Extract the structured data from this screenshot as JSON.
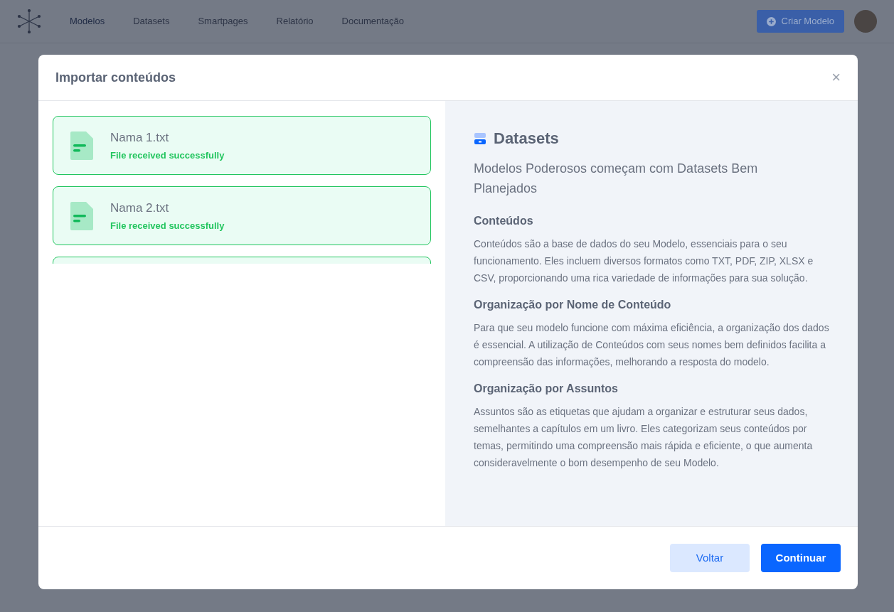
{
  "nav": {
    "items": [
      {
        "label": "Modelos",
        "selected": true
      },
      {
        "label": "Datasets",
        "selected": false
      },
      {
        "label": "Smartpages",
        "selected": false
      },
      {
        "label": "Relatório",
        "selected": false
      },
      {
        "label": "Documentação",
        "selected": false
      }
    ],
    "create_button": "Criar Modelo"
  },
  "modal": {
    "title": "Importar conteúdos",
    "close": "×",
    "files": [
      {
        "name": "Nama 1.txt",
        "status": "File received successfully"
      },
      {
        "name": "Nama 2.txt",
        "status": "File received successfully"
      }
    ],
    "info": {
      "title": "Datasets",
      "subtitle": "Modelos Poderosos começam com Datasets Bem Planejados",
      "sections": [
        {
          "heading": "Conteúdos",
          "text": "Conteúdos são a base de dados do seu Modelo, essenciais para o seu funcionamento. Eles incluem diversos formatos como TXT, PDF, ZIP, XLSX e CSV, proporcionando uma rica variedade de informações para sua solução."
        },
        {
          "heading": "Organização por Nome de Conteúdo",
          "text": "Para que seu modelo funcione com máxima eficiência, a organização dos dados é essencial. A utilização de Conteúdos com seus nomes bem definidos facilita a compreensão das informações, melhorando a resposta do modelo."
        },
        {
          "heading": "Organização por Assuntos",
          "text": "Assuntos são as etiquetas que ajudam a organizar e estruturar seus dados, semelhantes a capítulos em um livro. Eles categorizam seus conteúdos por temas, permitindo uma compreensão mais rápida e eficiente, o que aumenta consideravelmente o bom desempenho de seu Modelo."
        }
      ]
    },
    "buttons": [
      {
        "label": "Voltar",
        "kind": "secondary"
      },
      {
        "label": "Continuar",
        "kind": "primary"
      }
    ]
  }
}
